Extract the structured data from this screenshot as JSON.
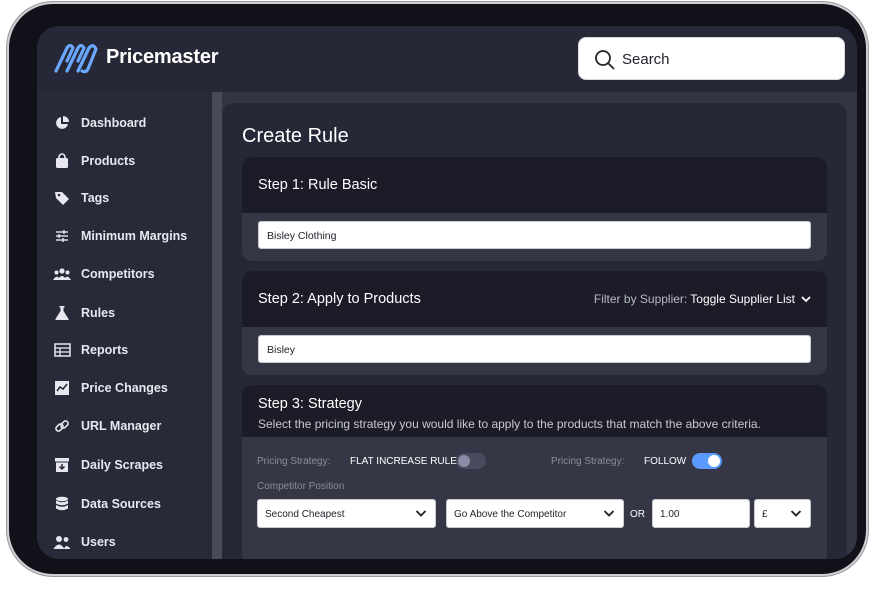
{
  "app": {
    "name": "Pricemaster"
  },
  "search": {
    "label": "Search"
  },
  "sidebar": {
    "items": [
      {
        "label": "Dashboard",
        "icon": "pie-chart-icon"
      },
      {
        "label": "Products",
        "icon": "shopping-bag-icon"
      },
      {
        "label": "Tags",
        "icon": "tag-icon"
      },
      {
        "label": "Minimum Margins",
        "icon": "sliders-icon"
      },
      {
        "label": "Competitors",
        "icon": "group-icon"
      },
      {
        "label": "Rules",
        "icon": "flask-icon"
      },
      {
        "label": "Reports",
        "icon": "table-icon"
      },
      {
        "label": "Price Changes",
        "icon": "trend-chart-icon"
      },
      {
        "label": "URL Manager",
        "icon": "link-icon"
      },
      {
        "label": "Daily Scrapes",
        "icon": "archive-download-icon"
      },
      {
        "label": "Data Sources",
        "icon": "database-icon"
      },
      {
        "label": "Users",
        "icon": "users-icon"
      }
    ]
  },
  "page": {
    "title": "Create Rule"
  },
  "step1": {
    "title": "Step 1: Rule Basic",
    "value": "Bisley Clothing"
  },
  "step2": {
    "title": "Step 2: Apply to Products",
    "filter_label": "Filter by Supplier:",
    "filter_action": "Toggle Supplier List",
    "value": "Bisley"
  },
  "step3": {
    "title": "Step 3: Strategy",
    "description": "Select the pricing strategy you would like to apply to the products that match the above criteria.",
    "strategy_label_1": "Pricing Strategy:",
    "strategy_value_1": "FLAT INCREASE RULE",
    "strategy_toggle_1_on": false,
    "strategy_label_2": "Pricing Strategy:",
    "strategy_value_2": "FOLLOW",
    "strategy_toggle_2_on": true,
    "position_label": "Competitor Position",
    "position_select": "Second Cheapest",
    "direction_select": "Go Above the Competitor",
    "or_label": "OR",
    "amount": "1.00",
    "currency": "£"
  },
  "colors": {
    "accent": "#5b9bff",
    "background": "#1b1c27",
    "panel": "#272837"
  }
}
